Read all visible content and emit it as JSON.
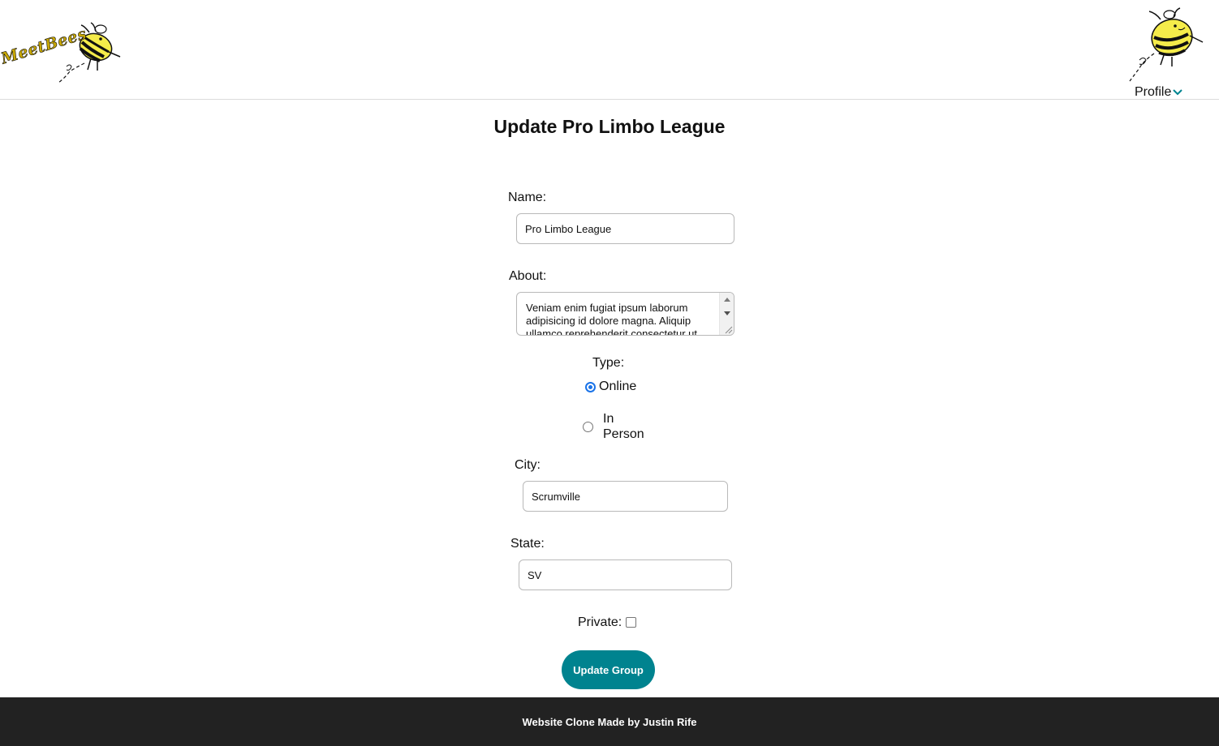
{
  "header": {
    "logo_alt": "MeetBees",
    "logo_text": "MeetBees",
    "profile_label": "Profile"
  },
  "form": {
    "title": "Update Pro Limbo League",
    "name_label": "Name:",
    "name_value": "Pro Limbo League",
    "about_label": "About:",
    "about_value": "Veniam enim fugiat ipsum laborum adipisicing id dolore magna. Aliquip ullamco reprehenderit consectetur ut",
    "type_label": "Type:",
    "type_options": [
      {
        "label": "Online",
        "checked": true
      },
      {
        "label_line1": "In",
        "label_line2": "Person",
        "checked": false
      }
    ],
    "city_label": "City:",
    "city_value": "Scrumville",
    "state_label": "State:",
    "state_value": "SV",
    "private_label": "Private:",
    "private_checked": false,
    "submit_label": "Update Group"
  },
  "footer": {
    "text": "Website Clone Made by Justin Rife"
  },
  "colors": {
    "accent": "#00838f",
    "footer_bg": "#222222",
    "bee_yellow": "#f5ec4a",
    "radio_blue": "#1a73e8"
  }
}
